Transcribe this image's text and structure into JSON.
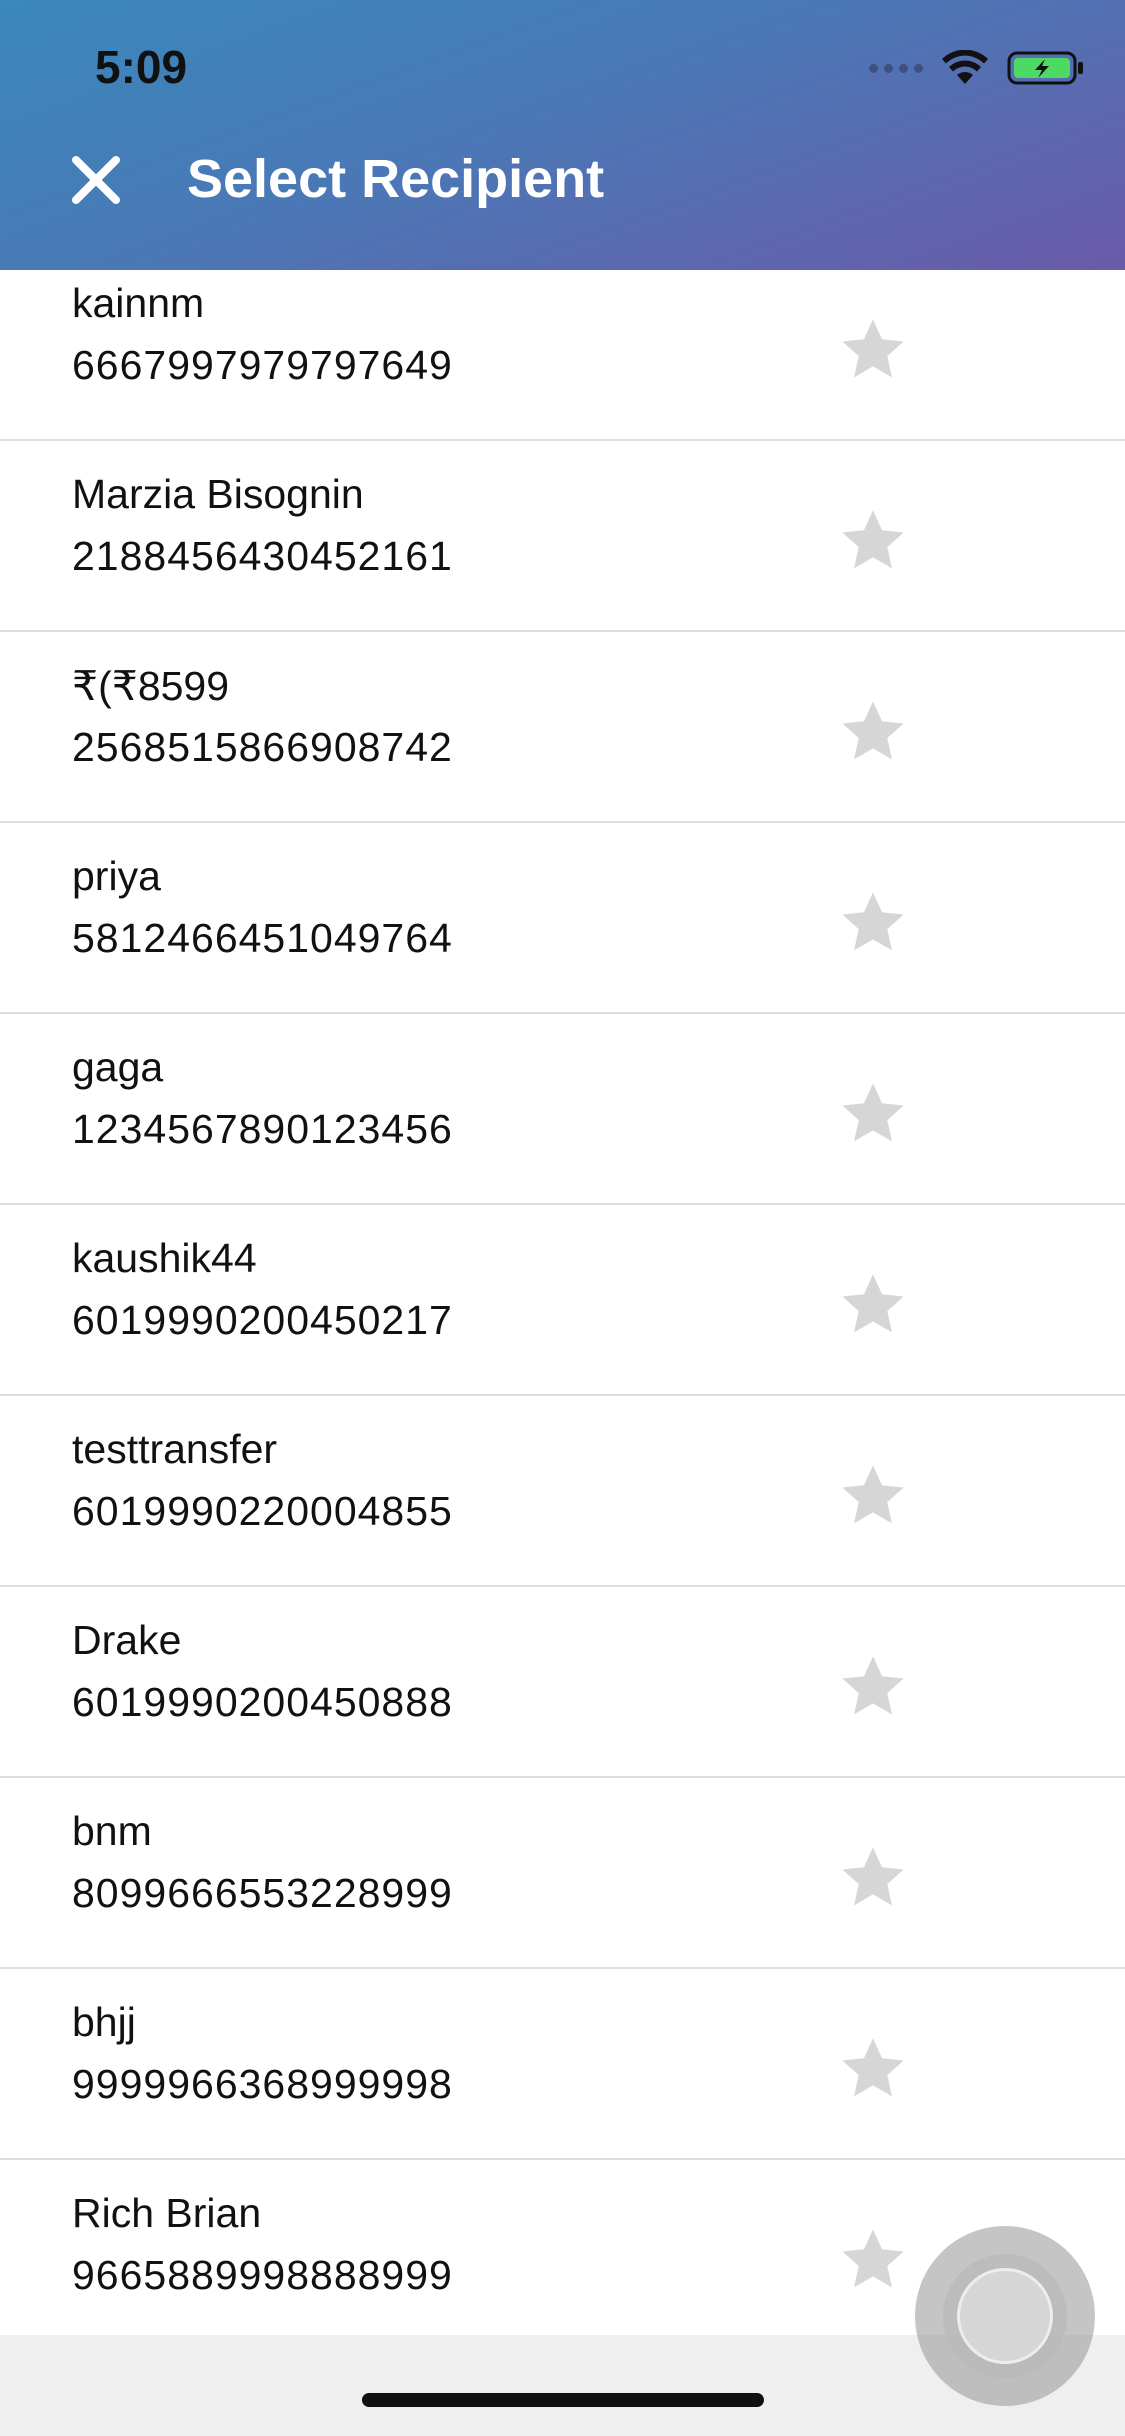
{
  "status_bar": {
    "time": "5:09"
  },
  "header": {
    "title": "Select Recipient",
    "close_icon": "close-icon"
  },
  "recipients": [
    {
      "name": "kainnm",
      "number": "6667997979797649",
      "favorite": false
    },
    {
      "name": "Marzia Bisognin",
      "number": "2188456430452161",
      "favorite": false
    },
    {
      "name": "₹(₹8599",
      "number": "2568515866908742",
      "favorite": false
    },
    {
      "name": "priya",
      "number": "5812466451049764",
      "favorite": false
    },
    {
      "name": "gaga",
      "number": "1234567890123456",
      "favorite": false
    },
    {
      "name": "kaushik44",
      "number": "6019990200450217",
      "favorite": false
    },
    {
      "name": "testtransfer",
      "number": "6019990220004855",
      "favorite": false
    },
    {
      "name": "Drake",
      "number": "6019990200450888",
      "favorite": false
    },
    {
      "name": "bnm",
      "number": "8099666553228999",
      "favorite": false
    },
    {
      "name": "bhjj",
      "number": "9999966368999998",
      "favorite": false
    },
    {
      "name": "Rich Brian",
      "number": "9665889998888999",
      "favorite": false
    }
  ],
  "colors": {
    "header_gradient": [
      "#3a88bd",
      "#6a5aaa"
    ],
    "star_inactive": "#d6d6d6",
    "battery_fill": "#4cd964"
  }
}
